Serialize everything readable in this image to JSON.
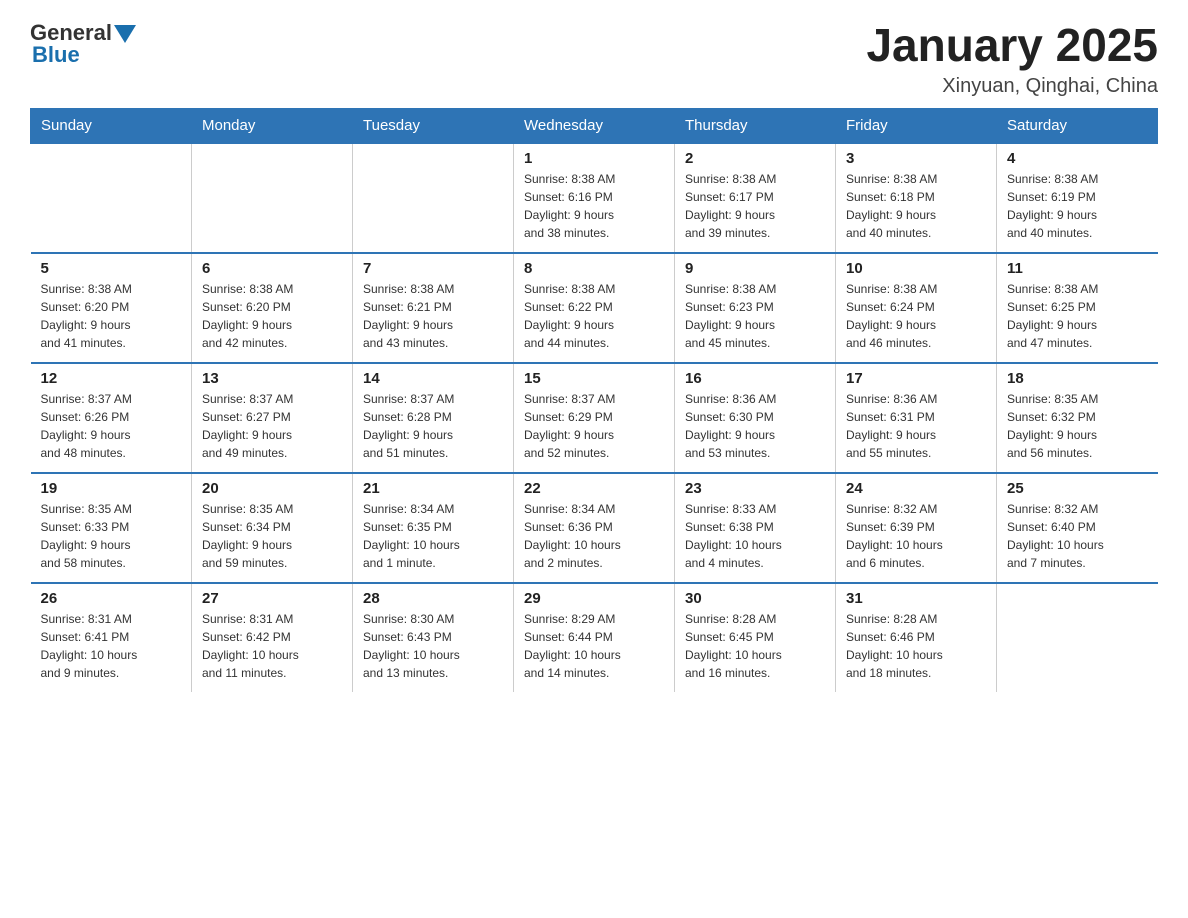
{
  "logo": {
    "general": "General",
    "blue": "Blue"
  },
  "header": {
    "month": "January 2025",
    "location": "Xinyuan, Qinghai, China"
  },
  "weekdays": [
    "Sunday",
    "Monday",
    "Tuesday",
    "Wednesday",
    "Thursday",
    "Friday",
    "Saturday"
  ],
  "weeks": [
    [
      {
        "day": "",
        "info": ""
      },
      {
        "day": "",
        "info": ""
      },
      {
        "day": "",
        "info": ""
      },
      {
        "day": "1",
        "info": "Sunrise: 8:38 AM\nSunset: 6:16 PM\nDaylight: 9 hours\nand 38 minutes."
      },
      {
        "day": "2",
        "info": "Sunrise: 8:38 AM\nSunset: 6:17 PM\nDaylight: 9 hours\nand 39 minutes."
      },
      {
        "day": "3",
        "info": "Sunrise: 8:38 AM\nSunset: 6:18 PM\nDaylight: 9 hours\nand 40 minutes."
      },
      {
        "day": "4",
        "info": "Sunrise: 8:38 AM\nSunset: 6:19 PM\nDaylight: 9 hours\nand 40 minutes."
      }
    ],
    [
      {
        "day": "5",
        "info": "Sunrise: 8:38 AM\nSunset: 6:20 PM\nDaylight: 9 hours\nand 41 minutes."
      },
      {
        "day": "6",
        "info": "Sunrise: 8:38 AM\nSunset: 6:20 PM\nDaylight: 9 hours\nand 42 minutes."
      },
      {
        "day": "7",
        "info": "Sunrise: 8:38 AM\nSunset: 6:21 PM\nDaylight: 9 hours\nand 43 minutes."
      },
      {
        "day": "8",
        "info": "Sunrise: 8:38 AM\nSunset: 6:22 PM\nDaylight: 9 hours\nand 44 minutes."
      },
      {
        "day": "9",
        "info": "Sunrise: 8:38 AM\nSunset: 6:23 PM\nDaylight: 9 hours\nand 45 minutes."
      },
      {
        "day": "10",
        "info": "Sunrise: 8:38 AM\nSunset: 6:24 PM\nDaylight: 9 hours\nand 46 minutes."
      },
      {
        "day": "11",
        "info": "Sunrise: 8:38 AM\nSunset: 6:25 PM\nDaylight: 9 hours\nand 47 minutes."
      }
    ],
    [
      {
        "day": "12",
        "info": "Sunrise: 8:37 AM\nSunset: 6:26 PM\nDaylight: 9 hours\nand 48 minutes."
      },
      {
        "day": "13",
        "info": "Sunrise: 8:37 AM\nSunset: 6:27 PM\nDaylight: 9 hours\nand 49 minutes."
      },
      {
        "day": "14",
        "info": "Sunrise: 8:37 AM\nSunset: 6:28 PM\nDaylight: 9 hours\nand 51 minutes."
      },
      {
        "day": "15",
        "info": "Sunrise: 8:37 AM\nSunset: 6:29 PM\nDaylight: 9 hours\nand 52 minutes."
      },
      {
        "day": "16",
        "info": "Sunrise: 8:36 AM\nSunset: 6:30 PM\nDaylight: 9 hours\nand 53 minutes."
      },
      {
        "day": "17",
        "info": "Sunrise: 8:36 AM\nSunset: 6:31 PM\nDaylight: 9 hours\nand 55 minutes."
      },
      {
        "day": "18",
        "info": "Sunrise: 8:35 AM\nSunset: 6:32 PM\nDaylight: 9 hours\nand 56 minutes."
      }
    ],
    [
      {
        "day": "19",
        "info": "Sunrise: 8:35 AM\nSunset: 6:33 PM\nDaylight: 9 hours\nand 58 minutes."
      },
      {
        "day": "20",
        "info": "Sunrise: 8:35 AM\nSunset: 6:34 PM\nDaylight: 9 hours\nand 59 minutes."
      },
      {
        "day": "21",
        "info": "Sunrise: 8:34 AM\nSunset: 6:35 PM\nDaylight: 10 hours\nand 1 minute."
      },
      {
        "day": "22",
        "info": "Sunrise: 8:34 AM\nSunset: 6:36 PM\nDaylight: 10 hours\nand 2 minutes."
      },
      {
        "day": "23",
        "info": "Sunrise: 8:33 AM\nSunset: 6:38 PM\nDaylight: 10 hours\nand 4 minutes."
      },
      {
        "day": "24",
        "info": "Sunrise: 8:32 AM\nSunset: 6:39 PM\nDaylight: 10 hours\nand 6 minutes."
      },
      {
        "day": "25",
        "info": "Sunrise: 8:32 AM\nSunset: 6:40 PM\nDaylight: 10 hours\nand 7 minutes."
      }
    ],
    [
      {
        "day": "26",
        "info": "Sunrise: 8:31 AM\nSunset: 6:41 PM\nDaylight: 10 hours\nand 9 minutes."
      },
      {
        "day": "27",
        "info": "Sunrise: 8:31 AM\nSunset: 6:42 PM\nDaylight: 10 hours\nand 11 minutes."
      },
      {
        "day": "28",
        "info": "Sunrise: 8:30 AM\nSunset: 6:43 PM\nDaylight: 10 hours\nand 13 minutes."
      },
      {
        "day": "29",
        "info": "Sunrise: 8:29 AM\nSunset: 6:44 PM\nDaylight: 10 hours\nand 14 minutes."
      },
      {
        "day": "30",
        "info": "Sunrise: 8:28 AM\nSunset: 6:45 PM\nDaylight: 10 hours\nand 16 minutes."
      },
      {
        "day": "31",
        "info": "Sunrise: 8:28 AM\nSunset: 6:46 PM\nDaylight: 10 hours\nand 18 minutes."
      },
      {
        "day": "",
        "info": ""
      }
    ]
  ]
}
